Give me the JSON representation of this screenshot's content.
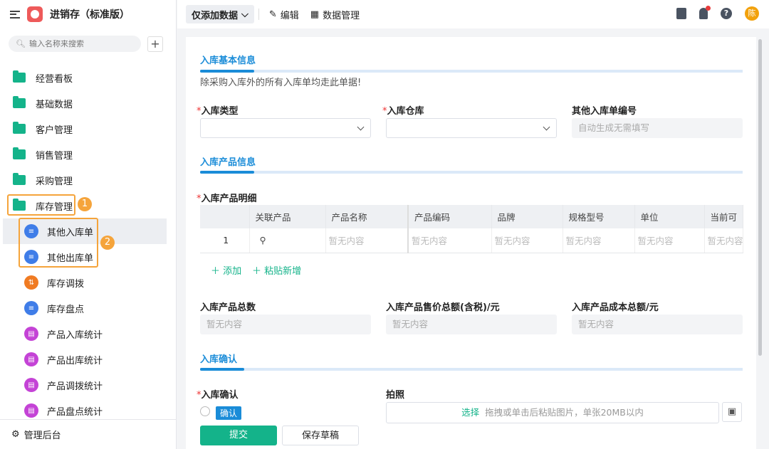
{
  "app": {
    "title": "进销存（标准版）",
    "search_placeholder": "输入名称来搜索"
  },
  "sidebar": {
    "items": [
      "经营看板",
      "基础数据",
      "客户管理",
      "销售管理",
      "采购管理",
      "库存管理"
    ],
    "sub_items": [
      "其他入库单",
      "其他出库单",
      "库存调拨",
      "库存盘点",
      "产品入库统计",
      "产品出库统计",
      "产品调拨统计",
      "产品盘点统计"
    ],
    "badges": [
      "1",
      "2"
    ],
    "admin": "管理后台"
  },
  "topbar": {
    "view": "仅添加数据",
    "edit": "编辑",
    "data_manage": "数据管理",
    "avatar": "陈"
  },
  "form": {
    "sec1": "入库基本信息",
    "sec1_desc": "除采购入库外的所有入库单均走此单据!",
    "type_label": "入库类型",
    "warehouse_label": "入库仓库",
    "number_label": "其他入库单编号",
    "number_placeholder": "自动生成无需填写",
    "sec2": "入库产品信息",
    "detail_label": "入库产品明细",
    "columns": [
      "",
      "关联产品",
      "产品名称",
      "产品编码",
      "品牌",
      "规格型号",
      "单位",
      "当前可"
    ],
    "row": {
      "index": "1",
      "empty": "暂无内容"
    },
    "add": "添加",
    "paste": "粘贴新增",
    "total_qty": "入库产品总数",
    "total_price": "入库产品售价总额(含税)/元",
    "total_cost": "入库产品成本总额/元",
    "empty": "暂无内容",
    "sec3": "入库确认",
    "confirm_label": "入库确认",
    "confirm_option": "确认",
    "photo_label": "拍照",
    "photo_select": "选择",
    "photo_hint": "拖拽或单击后粘贴图片，单张20MB以内",
    "submit": "提交",
    "draft": "保存草稿"
  },
  "colors": {
    "accent": "#14b38a",
    "section": "#1a8cd8",
    "highlight": "#f5a43b"
  }
}
